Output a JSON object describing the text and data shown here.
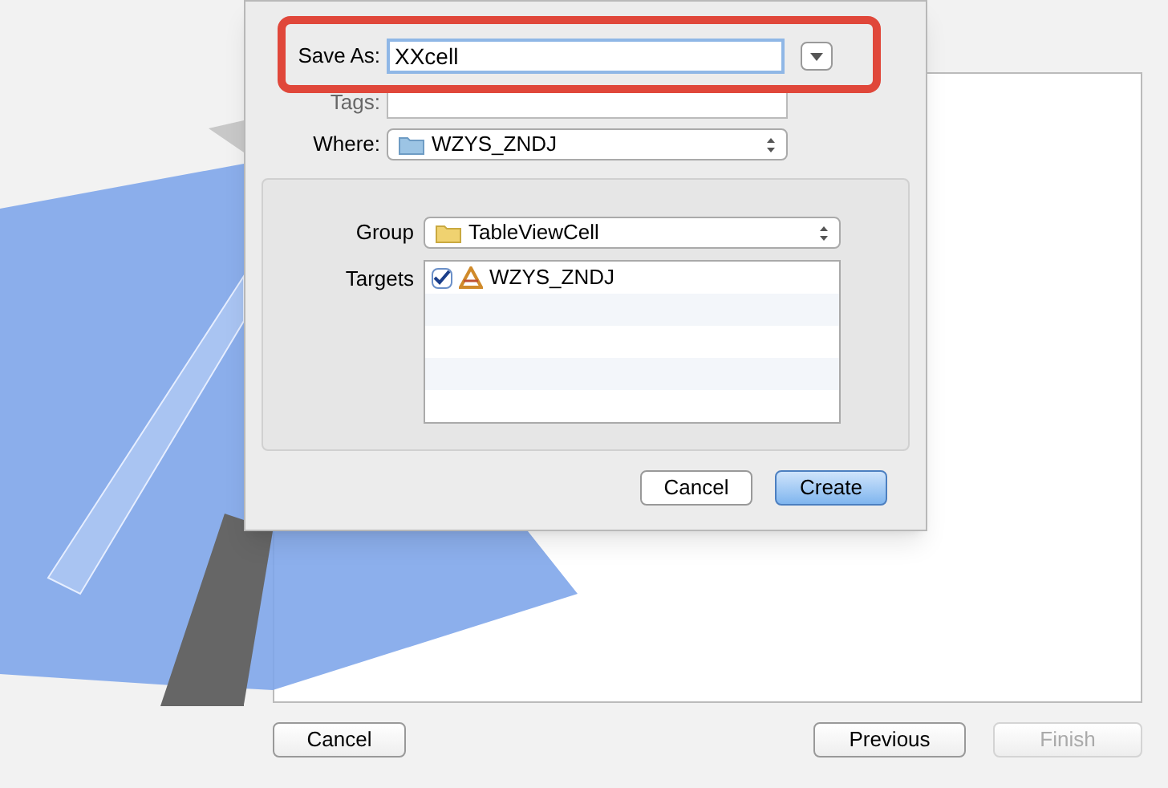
{
  "sheet": {
    "save_as": {
      "label": "Save As:",
      "value": "XXcell"
    },
    "tags": {
      "label": "Tags:"
    },
    "where": {
      "label": "Where:",
      "value": "WZYS_ZNDJ"
    },
    "group": {
      "label": "Group",
      "value": "TableViewCell"
    },
    "targets": {
      "label": "Targets",
      "items": [
        {
          "name": "WZYS_ZNDJ",
          "checked": true
        }
      ]
    },
    "buttons": [
      {
        "label": "Cancel",
        "kind": "normal"
      },
      {
        "label": "Create",
        "kind": "default"
      }
    ]
  },
  "footer_buttons": [
    {
      "label": "Cancel",
      "disabled": false
    },
    {
      "label": "Previous",
      "disabled": false
    },
    {
      "label": "Finish",
      "disabled": true
    }
  ]
}
